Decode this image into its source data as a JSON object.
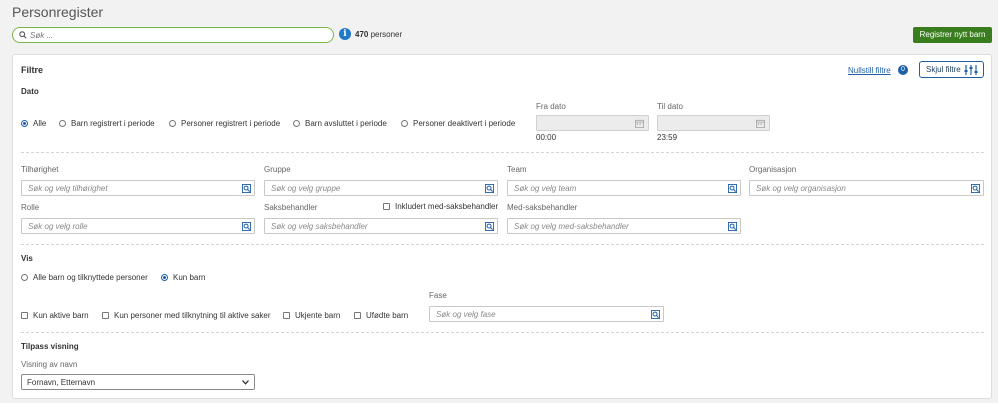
{
  "page": {
    "title": "Personregister"
  },
  "search": {
    "placeholder": "Søk ..."
  },
  "summary": {
    "count": "470",
    "unit": "personer"
  },
  "buttons": {
    "new_child": "Registrer nytt barn",
    "hide_filters": "Skjul filtre",
    "reset_filters": "Nullstill filtre",
    "reset_count": "0"
  },
  "filters": {
    "heading": "Filtre",
    "date": {
      "heading": "Dato",
      "options": [
        "Alle",
        "Barn registrert i periode",
        "Personer registrert i periode",
        "Barn avsluttet i periode",
        "Personer deaktivert i periode"
      ],
      "selected": "Alle",
      "from_label": "Fra dato",
      "to_label": "Til dato",
      "from_time": "00:00",
      "to_time": "23:59"
    },
    "fields": {
      "tilhorighet": {
        "label": "Tilhørighet",
        "placeholder": "Søk og velg tilhørighet"
      },
      "gruppe": {
        "label": "Gruppe",
        "placeholder": "Søk og velg gruppe"
      },
      "team": {
        "label": "Team",
        "placeholder": "Søk og velg team"
      },
      "organisasjon": {
        "label": "Organisasjon",
        "placeholder": "Søk og velg organisasjon"
      },
      "rolle": {
        "label": "Rolle",
        "placeholder": "Søk og velg rolle"
      },
      "saksbehandler": {
        "label": "Saksbehandler",
        "placeholder": "Søk og velg saksbehandler"
      },
      "inkluder_med": {
        "label": "Inkludert med-saksbehandler"
      },
      "med_saksbehandler": {
        "label": "Med-saksbehandler",
        "placeholder": "Søk og velg med-saksbehandler"
      }
    },
    "vis": {
      "heading": "Vis",
      "options": [
        "Alle barn og tilknyttede personer",
        "Kun barn"
      ],
      "selected": "Kun barn",
      "checkboxes": [
        "Kun aktive barn",
        "Kun personer med tilknytning til aktive saker",
        "Ukjente barn",
        "Ufødte barn"
      ],
      "fase_label": "Fase",
      "fase_placeholder": "Søk og velg fase"
    },
    "tilpass": {
      "heading": "Tilpass visning",
      "name_display_label": "Visning av navn",
      "name_display_value": "Fornavn, Etternavn"
    }
  },
  "colors": {
    "accent": "#1f5fa8",
    "green": "#3a7d1e",
    "search_border": "#7ab648",
    "info": "#1f78c8"
  },
  "icons": [
    "search-icon",
    "info-icon",
    "sliders-icon",
    "calendar-icon",
    "search-select-icon",
    "chevron-down-icon"
  ]
}
